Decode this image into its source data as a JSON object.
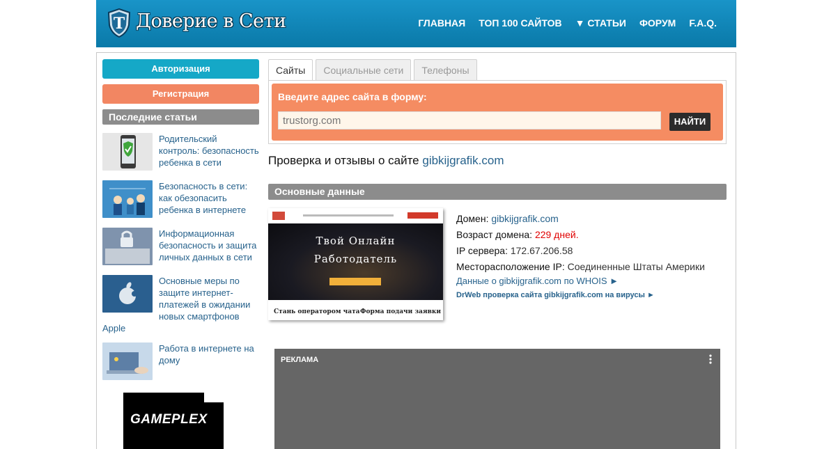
{
  "header": {
    "logo_text": "Доверие в Сети",
    "nav": [
      "ГЛАВНАЯ",
      "ТОП 100 САЙТОВ",
      "▼ СТАТЬИ",
      "ФОРУМ",
      "F.A.Q."
    ]
  },
  "sidebar": {
    "auth_label": "Авторизация",
    "register_label": "Регистрация",
    "recent_heading": "Последние статьи",
    "articles": [
      {
        "title": "Родительский контроль: безопасность ребенка в сети",
        "thumb": "phone-shield-icon"
      },
      {
        "title": "Безопасность в сети: как обезопасить ребенка в интернете",
        "thumb": "family-network-icon"
      },
      {
        "title": "Информационная безопасность и защита личных данных в сети",
        "thumb": "lock-keyboard-icon"
      },
      {
        "title": "Основные меры по защите интернет-платежей в ожидании новых смартфонов Apple",
        "thumb": "apple-logo-icon"
      },
      {
        "title": "Работа в интернете на дому",
        "thumb": "laptop-hands-icon"
      }
    ],
    "ad_text": "GAMEPLEX"
  },
  "main": {
    "tabs": [
      "Сайты",
      "Социальные сети",
      "Телефоны"
    ],
    "active_tab": "Сайты",
    "form_label": "Введите адрес сайта в форму:",
    "input_placeholder": "trustorg.com",
    "find_button": "НАЙТИ",
    "check_title_prefix": "Проверка и отзывы о сайте",
    "check_domain": "gibkijgrafik.com",
    "section_heading": "Основные данные",
    "screenshot": {
      "hero_line1": "Твой Онлайн",
      "hero_line2": "Работодатель",
      "bottom_left": "Стань оператором чата",
      "bottom_right": "Форма подачи заявки"
    },
    "info": {
      "domain_label": "Домен:",
      "domain_value": "gibkijgrafik.com",
      "age_label": "Возраст домена:",
      "age_value": "229 дней.",
      "ip_label": "IP сервера:",
      "ip_value": "172.67.206.58",
      "location_label": "Месторасположение IP:",
      "location_value": "Соединенные Штаты Америки",
      "whois_link": "Данные о gibkijgrafik.com по WHOIS ►",
      "drweb_link": "DrWeb проверка сайта gibkijgrafik.com на вирусы ►"
    },
    "ad_label": "РЕКЛАМА"
  },
  "colors": {
    "header_blue": "#0f86b8",
    "auth_button": "#15a8c7",
    "register_button": "#f28662",
    "section_gray": "#8c8c8c",
    "link_blue": "#27628c",
    "alert_red": "#e00000"
  }
}
